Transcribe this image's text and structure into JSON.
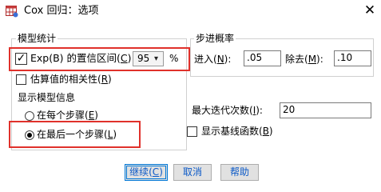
{
  "window": {
    "title": "Cox 回归：选项",
    "app_icon": "spss-table-icon",
    "close_icon": "close-icon"
  },
  "model_statistics": {
    "group_title": "模型统计",
    "ci_checkbox": {
      "label_pre": "Exp(B) 的置信区间(",
      "label_key": "C",
      "label_post": ")",
      "checked": true
    },
    "ci_value": "95",
    "ci_unit": "%",
    "correlation_checkbox": {
      "label_pre": "估算值的相关性(",
      "label_key": "R",
      "label_post": ")",
      "checked": false
    },
    "display_heading": "显示模型信息",
    "radio_each_step": {
      "label_pre": "在每个步骤(",
      "label_key": "E",
      "label_post": ")",
      "selected": false
    },
    "radio_last_step": {
      "label_pre": "在最后一个步骤(",
      "label_key": "L",
      "label_post": ")",
      "selected": true
    }
  },
  "stepwise_probability": {
    "group_title": "步进概率",
    "entry_label_pre": "进入(",
    "entry_label_key": "N",
    "entry_label_post": "):",
    "entry_value": ".05",
    "removal_label_pre": "除去(",
    "removal_label_key": "M",
    "removal_label_post": "):",
    "removal_value": ".10"
  },
  "max_iterations": {
    "label_pre": "最大迭代次数(",
    "label_key": "I",
    "label_post": "):",
    "value": "20"
  },
  "baseline_checkbox": {
    "label_pre": "显示基线函数(",
    "label_key": "B",
    "label_post": ")",
    "checked": false
  },
  "buttons": {
    "continue_pre": "继续(",
    "continue_key": "C",
    "continue_post": ")",
    "cancel": "取消",
    "help": "帮助"
  },
  "colors": {
    "highlight": "#e0312b",
    "primary_button_border": "#0078d7",
    "button_text": "#0b59c7"
  }
}
